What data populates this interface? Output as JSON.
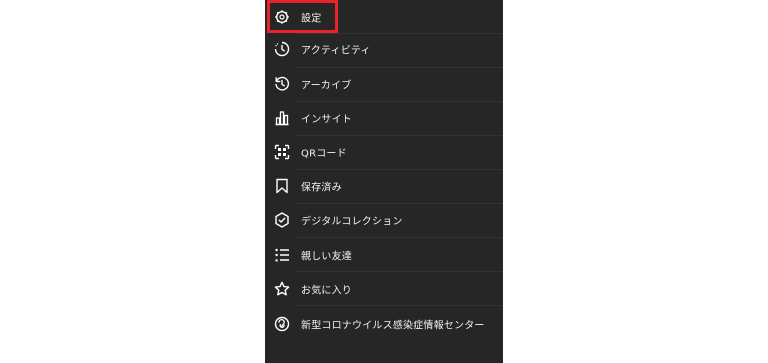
{
  "menu": {
    "items": [
      {
        "label": "設定",
        "icon": "gear-icon"
      },
      {
        "label": "アクティビティ",
        "icon": "activity-icon"
      },
      {
        "label": "アーカイブ",
        "icon": "archive-icon"
      },
      {
        "label": "インサイト",
        "icon": "insights-icon"
      },
      {
        "label": "QRコード",
        "icon": "qr-code-icon"
      },
      {
        "label": "保存済み",
        "icon": "bookmark-icon"
      },
      {
        "label": "デジタルコレクション",
        "icon": "verified-badge-icon"
      },
      {
        "label": "親しい友達",
        "icon": "close-friends-list-icon"
      },
      {
        "label": "お気に入り",
        "icon": "star-icon"
      },
      {
        "label": "新型コロナウイルス感染症情報センター",
        "icon": "covid-info-icon"
      }
    ]
  },
  "colors": {
    "panel_bg": "#262626",
    "text": "#f2f2f2",
    "highlight": "#e8242a"
  }
}
